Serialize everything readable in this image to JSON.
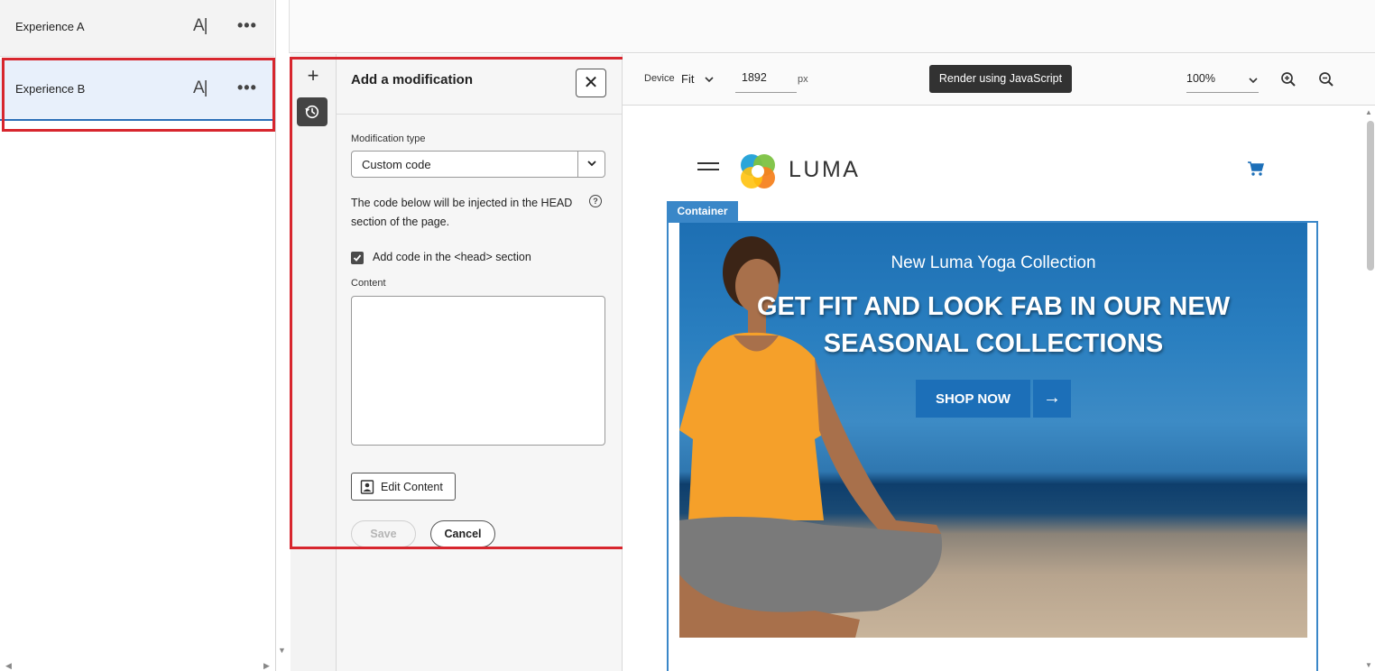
{
  "experiences": [
    {
      "label": "Experience A",
      "ai_label": "A|",
      "more": "•••"
    },
    {
      "label": "Experience B",
      "ai_label": "A|",
      "more": "•••"
    }
  ],
  "rail": {
    "add": "+"
  },
  "modification": {
    "title": "Add a modification",
    "close_symbol": "✕",
    "type_label": "Modification type",
    "type_value": "Custom code",
    "info_text": "The code below will be injected in the HEAD section of the page.",
    "help_symbol": "?",
    "checkbox_label": "Add code in the <head> section",
    "checkbox_checked": true,
    "content_label": "Content",
    "content_value": "",
    "edit_content_label": "Edit Content",
    "save_label": "Save",
    "cancel_label": "Cancel"
  },
  "toolbar": {
    "device_label": "Device",
    "device_value": "Fit",
    "width_value": "1892",
    "width_unit": "px",
    "render_label": "Render using JavaScript",
    "zoom_value": "100%"
  },
  "preview": {
    "brand": "LUMA",
    "container_tag": "Container",
    "banner_subtitle": "New Luma Yoga Collection",
    "banner_headline": "GET FIT AND LOOK FAB IN OUR NEW SEASONAL COLLECTIONS",
    "shop_label": "SHOP NOW",
    "shop_arrow": "→"
  },
  "colors": {
    "highlight": "#d7262e",
    "selected_bg": "#e8f0fb",
    "accent_blue": "#1c6fb8"
  },
  "icons": [
    "ai-rename-icon",
    "more-icon",
    "plus-icon",
    "history-icon",
    "close-icon",
    "chevron-down-icon",
    "help-icon",
    "check-icon",
    "edit-content-icon",
    "zoom-in-icon",
    "zoom-out-icon",
    "hamburger-icon",
    "luma-logo",
    "cart-icon",
    "arrow-right-icon"
  ]
}
